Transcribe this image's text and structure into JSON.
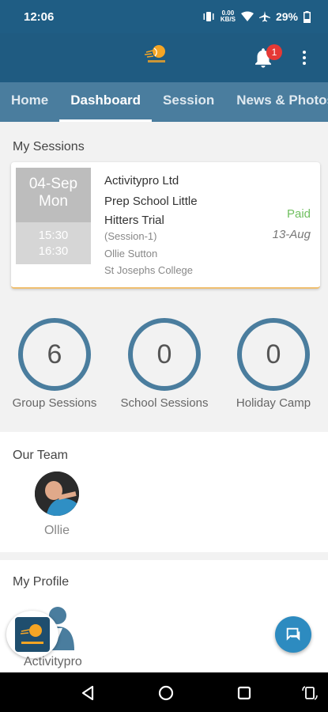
{
  "status_bar": {
    "time": "12:06",
    "speed_value": "0.00",
    "speed_unit": "KB/S",
    "battery": "29%"
  },
  "app_bar": {
    "logo_icon": "tennis-ball-logo-icon",
    "notification_count": "1"
  },
  "tabs": [
    {
      "label": "Home",
      "active": false
    },
    {
      "label": "Dashboard",
      "active": true
    },
    {
      "label": "Session",
      "active": false
    },
    {
      "label": "News & Photos",
      "active": false
    }
  ],
  "my_sessions": {
    "title": "My Sessions",
    "card": {
      "date": "04-Sep",
      "day": "Mon",
      "start_time": "15:30",
      "end_time": "16:30",
      "company": "Activitypro Ltd",
      "name": "Prep School Little Hitters Trial",
      "session_code": "(Session-1)",
      "coach": "Ollie Sutton",
      "venue": "St Josephs College",
      "payment_status": "Paid",
      "payment_date": "13-Aug"
    }
  },
  "stats": [
    {
      "value": "6",
      "label": "Group Sessions"
    },
    {
      "value": "0",
      "label": "School Sessions"
    },
    {
      "value": "0",
      "label": "Holiday Camp"
    }
  ],
  "our_team": {
    "title": "Our Team",
    "members": [
      {
        "name": "Ollie"
      }
    ]
  },
  "my_profile": {
    "title": "My Profile",
    "name": "Activitypro"
  },
  "colors": {
    "primary": "#1f5b81",
    "tab_bar": "#4a7d9e",
    "paid": "#6fbf5f",
    "fab": "#2d8bc0",
    "badge": "#e53935"
  }
}
